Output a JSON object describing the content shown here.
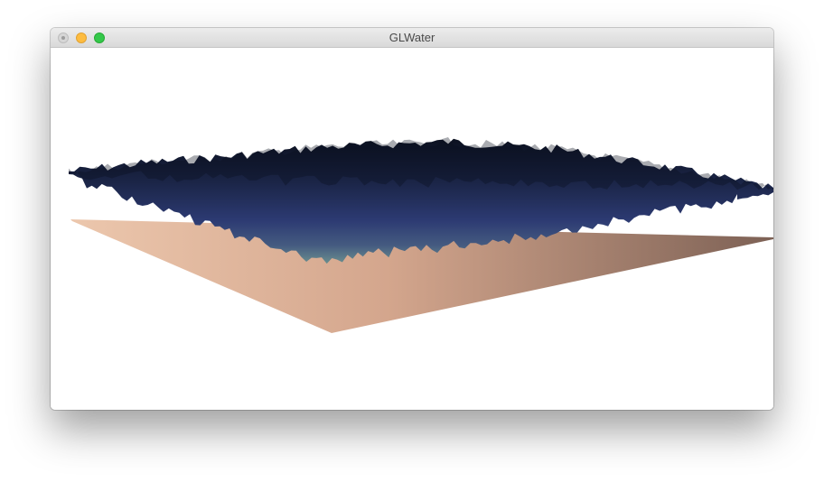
{
  "window": {
    "title": "GLWater"
  },
  "scene": {
    "floor_colors": [
      "#ecc7ad",
      "#d4a68d",
      "#7d6155"
    ],
    "water_colors": [
      "#0c1120",
      "#2c3a72",
      "#6a8e8e"
    ],
    "background": "#ffffff"
  }
}
